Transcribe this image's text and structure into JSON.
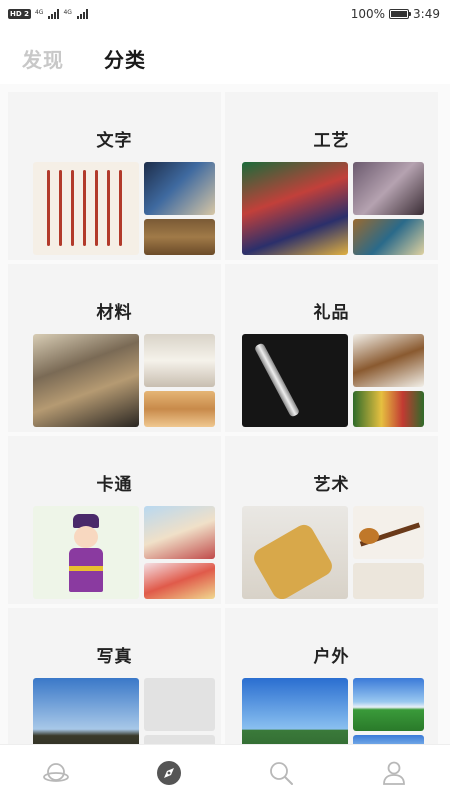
{
  "status_bar": {
    "hd_label": "HD",
    "hd_sub": "2",
    "signal1_label": "4G",
    "signal2_label": "4G",
    "battery_text": "100%",
    "battery_level": 1.0,
    "time": "3:49"
  },
  "top_tabs": [
    {
      "label": "发现",
      "active": false
    },
    {
      "label": "分类",
      "active": true
    }
  ],
  "categories": [
    {
      "title": "文字"
    },
    {
      "title": "工艺"
    },
    {
      "title": "材料"
    },
    {
      "title": "礼品"
    },
    {
      "title": "卡通"
    },
    {
      "title": "艺术"
    },
    {
      "title": "写真"
    },
    {
      "title": "户外"
    }
  ],
  "bottom_nav": [
    {
      "icon": "planet-icon",
      "active": false
    },
    {
      "icon": "compass-icon",
      "active": true
    },
    {
      "icon": "search-icon",
      "active": false
    },
    {
      "icon": "user-icon",
      "active": false
    }
  ],
  "colors": {
    "active_text": "#1a1a1a",
    "inactive_text": "#c8c8c8",
    "nav_active": "#555555",
    "nav_inactive": "#b8b8b8"
  }
}
